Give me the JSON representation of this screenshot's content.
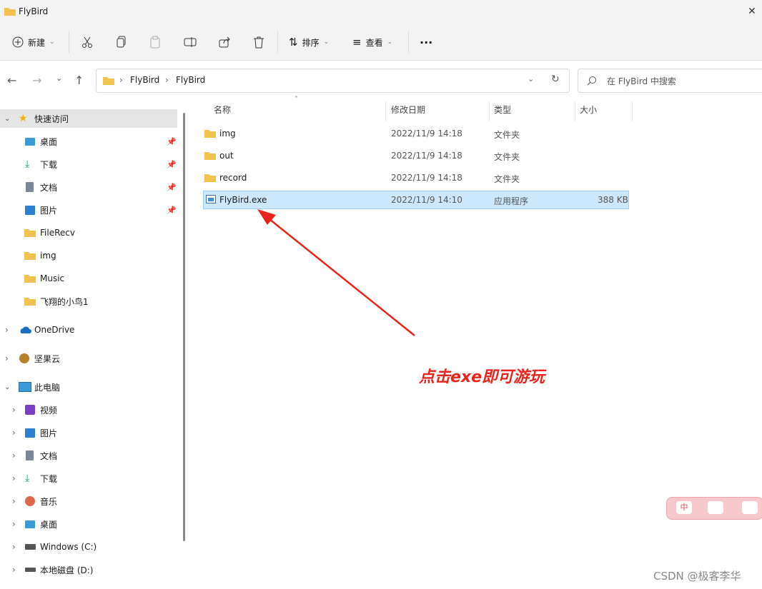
{
  "window": {
    "title": "FlyBird"
  },
  "toolbar": {
    "new_label": "新建",
    "sort_label": "排序",
    "view_label": "查看",
    "more_label": "···"
  },
  "address": {
    "crumbs": [
      "FlyBird",
      "FlyBird"
    ]
  },
  "search": {
    "placeholder": "在 FlyBird 中搜索"
  },
  "sidebar": {
    "quick_access": "快速访问",
    "pinned": [
      {
        "label": "桌面",
        "icon": "desktop-icon"
      },
      {
        "label": "下载",
        "icon": "download-icon"
      },
      {
        "label": "文档",
        "icon": "document-icon"
      },
      {
        "label": "图片",
        "icon": "picture-icon"
      }
    ],
    "recent": [
      "FileRecv",
      "img",
      "Music",
      "飞翔的小鸟1"
    ],
    "onedrive": "OneDrive",
    "jianguoyun": "坚果云",
    "this_pc": "此电脑",
    "pc_items": [
      {
        "label": "视频",
        "icon": "video-icon"
      },
      {
        "label": "图片",
        "icon": "picture-icon"
      },
      {
        "label": "文档",
        "icon": "document-icon"
      },
      {
        "label": "下载",
        "icon": "download-icon"
      },
      {
        "label": "音乐",
        "icon": "music-icon"
      },
      {
        "label": "桌面",
        "icon": "desktop-icon"
      },
      {
        "label": "Windows (C:)",
        "icon": "drive-c-icon"
      },
      {
        "label": "本地磁盘 (D:)",
        "icon": "drive-d-icon"
      }
    ]
  },
  "file_list": {
    "columns": {
      "name": "名称",
      "modified": "修改日期",
      "type": "类型",
      "size": "大小"
    },
    "rows": [
      {
        "name": "img",
        "modified": "2022/11/9 14:18",
        "type": "文件夹",
        "size": ""
      },
      {
        "name": "out",
        "modified": "2022/11/9 14:18",
        "type": "文件夹",
        "size": ""
      },
      {
        "name": "record",
        "modified": "2022/11/9 14:18",
        "type": "文件夹",
        "size": ""
      },
      {
        "name": "FlyBird.exe",
        "modified": "2022/11/9 14:10",
        "type": "应用程序",
        "size": "388 KB"
      }
    ]
  },
  "annotation": {
    "text": "点击exe即可游玩",
    "color": "#e8241c"
  },
  "watermark": {
    "text": "CSDN @极客李华"
  },
  "colors": {
    "folder": "#f2c14e",
    "selection": "#cce8ff",
    "accent": "#0067c0"
  }
}
